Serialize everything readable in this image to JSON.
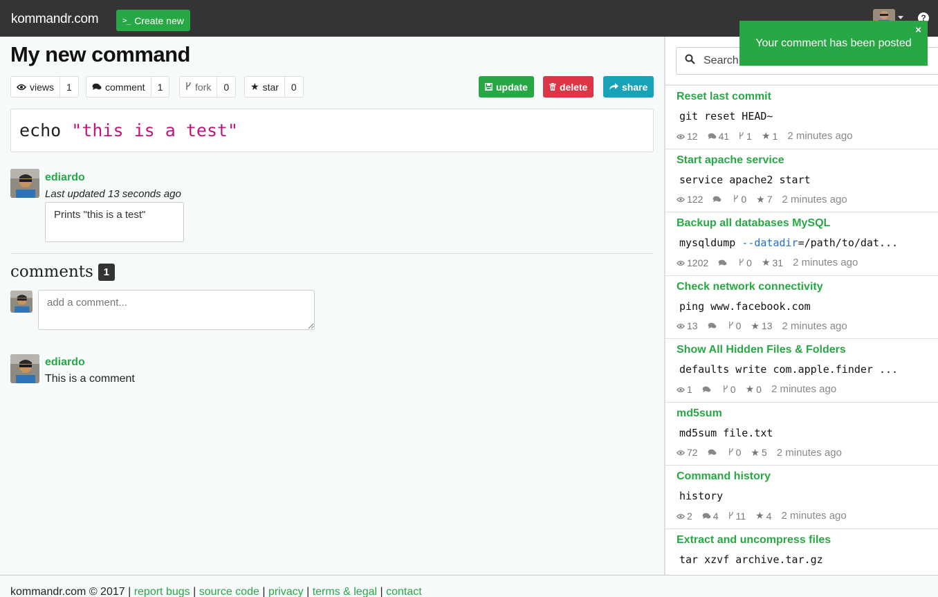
{
  "navbar": {
    "brand": "kommandr.com",
    "create_prompt": ">_",
    "create_label": "Create new",
    "help": "?"
  },
  "command": {
    "title": "My new command",
    "stats": {
      "views_label": "views",
      "views": "1",
      "comment_label": "comment",
      "comments": "1",
      "fork_label": "fork",
      "forks": "0",
      "star_label": "star",
      "stars": "0"
    },
    "actions": {
      "update": "update",
      "delete": "delete",
      "share": "share",
      "update_color": "#28a745",
      "delete_color": "#dc3545",
      "share_color": "#17a2b8"
    },
    "code_cmd": "echo",
    "code_str": "\"this is a test\"",
    "author": "ediardo",
    "updated": "Last updated 13 seconds ago",
    "description": "Prints \"this is a test\""
  },
  "comments": {
    "heading": "comments",
    "count": "1",
    "placeholder": "add a comment...",
    "items": [
      {
        "author": "ediardo",
        "text": "This is a comment"
      }
    ]
  },
  "sidebar": {
    "search_placeholder": "Search",
    "items": [
      {
        "title": "Reset last commit",
        "code": "git reset HEAD~",
        "views": "12",
        "comments": "41",
        "forks": "1",
        "stars": "1",
        "time": "2 minutes ago"
      },
      {
        "title": "Start apache service",
        "code": "service apache2 start",
        "views": "122",
        "comments": "",
        "forks": "0",
        "stars": "7",
        "time": "2 minutes ago"
      },
      {
        "title": "Backup all databases MySQL",
        "code_pre": "mysqldump ",
        "code_opt": "--datadir",
        "code_post": "=/path/to/dat...",
        "views": "1202",
        "comments": "",
        "forks": "0",
        "stars": "31",
        "time": "2 minutes ago"
      },
      {
        "title": "Check network connectivity",
        "code": "ping www.facebook.com",
        "views": "13",
        "comments": "",
        "forks": "0",
        "stars": "13",
        "time": "2 minutes ago"
      },
      {
        "title": "Show All Hidden Files & Folders",
        "code": "defaults write com.apple.finder ...",
        "views": "1",
        "comments": "",
        "forks": "0",
        "stars": "0",
        "time": "2 minutes ago"
      },
      {
        "title": "md5sum",
        "code": "md5sum file.txt",
        "views": "72",
        "comments": "",
        "forks": "0",
        "stars": "5",
        "time": "2 minutes ago"
      },
      {
        "title": "Command history",
        "code": "history",
        "views": "2",
        "comments": "4",
        "forks": "11",
        "stars": "4",
        "time": "2 minutes ago"
      },
      {
        "title": "Extract and uncompress files",
        "code": "tar xzvf archive.tar.gz",
        "views": "",
        "comments": "",
        "forks": "",
        "stars": "",
        "time": ""
      }
    ]
  },
  "toast": {
    "message": "Your comment has been posted",
    "close": "×"
  },
  "footer": {
    "copyright": "kommandr.com © 2017",
    "sep": "|",
    "links": [
      "report bugs",
      "source code",
      "privacy",
      "terms & legal",
      "contact"
    ]
  }
}
